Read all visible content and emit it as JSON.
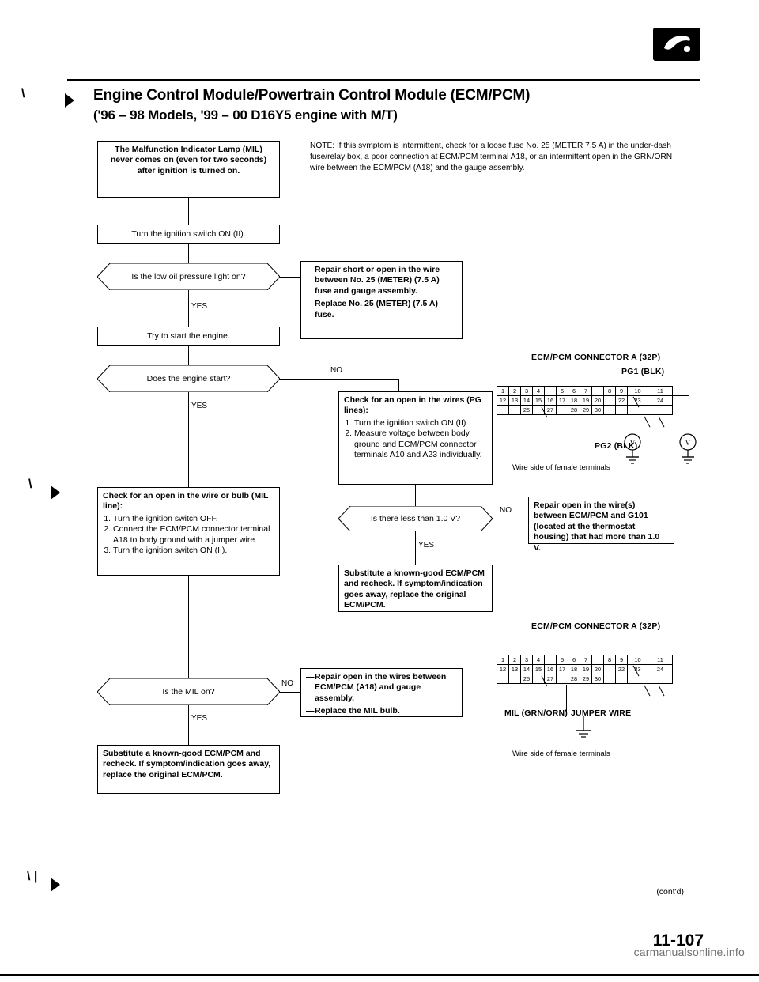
{
  "page": {
    "number": "11-107",
    "contd": "(cont'd)",
    "watermark": "carmanualsonline.info"
  },
  "header": {
    "title_line1": "Engine Control Module/Powertrain Control Module (ECM/PCM)",
    "title_line2": "('96 – 98 Models, '99 – 00 D16Y5 engine with M/T)"
  },
  "note": "NOTE: If this symptom is intermittent, check for a loose fuse No. 25 (METER 7.5 A) in the under-dash fuse/relay box, a poor connection at ECM/PCM terminal A18, or an intermittent open in the GRN/ORN wire between the ECM/PCM (A18) and the gauge assembly.",
  "flow": {
    "start": "The Malfunction Indicator Lamp (MIL) never comes on (even for two seconds) after ignition is turned on.",
    "step_ign_on": "Turn the ignition switch ON (II).",
    "q_low_oil": "Is the low oil pressure light on?",
    "step_try_start": "Try to start the engine.",
    "q_engine_start": "Does the engine start?",
    "repair_meter_fuse": {
      "items": [
        "Repair short or open in the wire between No. 25 (METER) (7.5 A) fuse and gauge assembly.",
        "Replace No. 25 (METER) (7.5 A) fuse."
      ]
    },
    "check_pg": {
      "title": "Check for an open in the wires (PG lines):",
      "steps": [
        "Turn the ignition switch ON (II).",
        "Measure voltage between body ground and ECM/PCM connector terminals A10 and A23 individually."
      ]
    },
    "q_less_1v": "Is there less than 1.0 V?",
    "repair_g101": "Repair open in the wire(s) between ECM/PCM and G101 (located at the thermostat housing) that had more than 1.0 V.",
    "substitute_1": "Substitute a known-good ECM/PCM and recheck. If symptom/indication goes away, replace the original ECM/PCM.",
    "check_mil_line": {
      "title": "Check for an open in the wire or bulb (MIL line):",
      "steps": [
        "Turn the ignition switch OFF.",
        "Connect the ECM/PCM connector terminal A18 to body ground with a jumper wire.",
        "Turn the ignition switch ON (II)."
      ]
    },
    "q_mil_on": "Is the MIL on?",
    "repair_mil": {
      "items": [
        "Repair open in the wires between ECM/PCM (A18) and gauge assembly.",
        "Replace the MIL bulb."
      ]
    },
    "substitute_2": "Substitute a known-good ECM/PCM and recheck. If symptom/indication goes away, replace the original ECM/PCM.",
    "yes": "YES",
    "no": "NO"
  },
  "connector_top": {
    "title": "ECM/PCM CONNECTOR A (32P)",
    "pg1_label": "PG1 (BLK)",
    "pg2_label": "PG2 (BLK)",
    "wire_side": "Wire side of female terminals",
    "rows": [
      [
        "1",
        "2",
        "3",
        "4",
        "",
        "5",
        "6",
        "7",
        "",
        "8",
        "9",
        "10",
        "11"
      ],
      [
        "12",
        "13",
        "14",
        "15",
        "16",
        "17",
        "18",
        "19",
        "20",
        "",
        "22",
        "23",
        "24"
      ],
      [
        "",
        "",
        "25",
        "",
        "27",
        "",
        "28",
        "29",
        "30",
        "",
        "",
        "",
        ""
      ]
    ]
  },
  "connector_bottom": {
    "title": "ECM/PCM CONNECTOR A (32P)",
    "mil_label": "MIL (GRN/ORN)",
    "jumper_label": "JUMPER WIRE",
    "wire_side": "Wire side of female terminals",
    "rows": [
      [
        "1",
        "2",
        "3",
        "4",
        "",
        "5",
        "6",
        "7",
        "",
        "8",
        "9",
        "10",
        "11"
      ],
      [
        "12",
        "13",
        "14",
        "15",
        "16",
        "17",
        "18",
        "19",
        "20",
        "",
        "22",
        "23",
        "24"
      ],
      [
        "",
        "",
        "25",
        "",
        "27",
        "",
        "28",
        "29",
        "30",
        "",
        "",
        "",
        ""
      ]
    ]
  }
}
